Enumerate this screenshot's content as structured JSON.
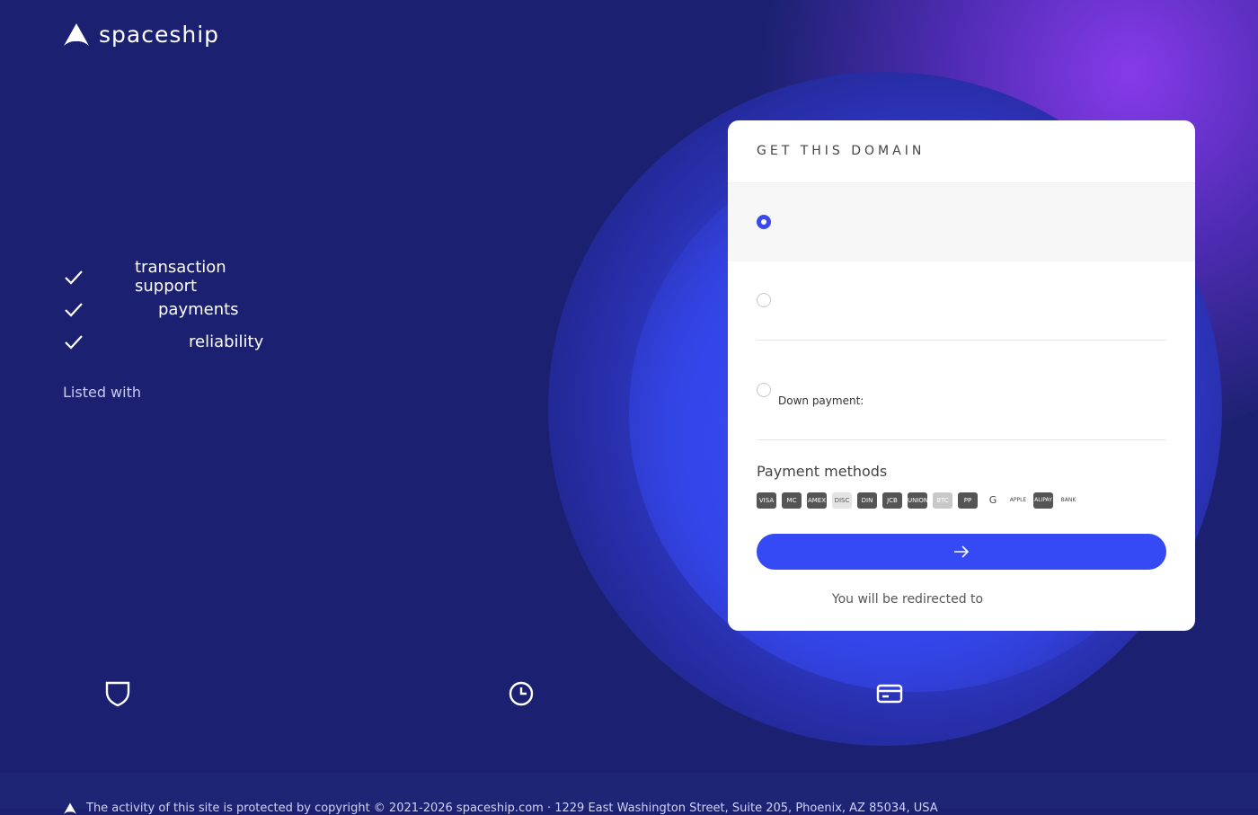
{
  "brand": {
    "name": "spaceship"
  },
  "features": [
    {
      "label": "transaction support",
      "icon": "check-icon"
    },
    {
      "label": "payments",
      "icon": "check-icon"
    },
    {
      "label": "reliability",
      "icon": "check-icon"
    }
  ],
  "listed_with": "Listed with",
  "card": {
    "title": "GET THIS DOMAIN",
    "options": [
      {
        "selected": true
      },
      {
        "selected": false
      },
      {
        "selected": false,
        "label": "Down payment:"
      }
    ],
    "payment_methods_title": "Payment methods",
    "payment_methods": [
      "VISA",
      "MC",
      "AMEX",
      "DISC",
      "DIN",
      "JCB",
      "UNION",
      "BTC",
      "PP",
      "G",
      "APPLE",
      "ALIPAY",
      "BANK"
    ],
    "submit_icon": "arrow-right-icon",
    "redirect_text": "You will be redirected to"
  },
  "bottom_icons": [
    "shield-icon",
    "clock-icon",
    "card-icon"
  ],
  "footer": {
    "text": "The activity of this site is protected by copyright © 2021-2026 spaceship.com · 1229 East Washington Street, Suite 205, Phoenix, AZ 85034, USA"
  },
  "colors": {
    "background": "#1b2170",
    "accent": "#3549f5",
    "glow": "#8c3cf0"
  }
}
